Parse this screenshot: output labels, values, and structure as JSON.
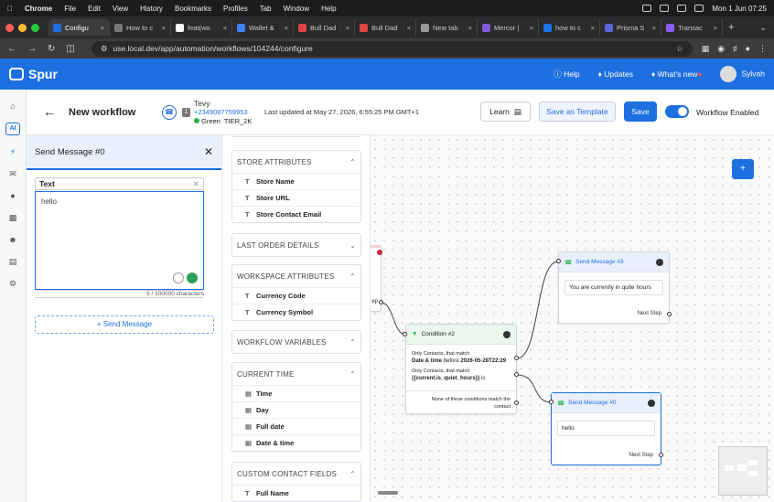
{
  "menubar": {
    "app": "Chrome",
    "items": [
      "File",
      "Edit",
      "View",
      "History",
      "Bookmarks",
      "Profiles",
      "Tab",
      "Window",
      "Help"
    ],
    "clock": "Mon 1 Jun  07:25"
  },
  "tabs": [
    {
      "label": "Configu",
      "color": "#1e6fe0",
      "active": true
    },
    {
      "label": "How to c",
      "color": "#777"
    },
    {
      "label": "feat(wo",
      "color": "#fff"
    },
    {
      "label": "Wallet &",
      "color": "#3c82f6"
    },
    {
      "label": "Bull Dad",
      "color": "#e04545"
    },
    {
      "label": "Bull Dad",
      "color": "#e04545"
    },
    {
      "label": "New tab",
      "color": "#999"
    },
    {
      "label": "Mercor |",
      "color": "#7b5bd6"
    },
    {
      "label": "how to c",
      "color": "#1a73e8"
    },
    {
      "label": "Prisma S",
      "color": "#5a67d8"
    },
    {
      "label": "Transac",
      "color": "#8b5cf6"
    }
  ],
  "address": {
    "url": "use.local.dev/app/automation/workflows/104244/configure"
  },
  "appbar": {
    "brand": "Spur",
    "help": "Help",
    "updates": "Updates",
    "whats_new": "What's new",
    "user": "Sylvah"
  },
  "sidebar": {
    "ai_label": "AI"
  },
  "header": {
    "title": "New workflow",
    "account_number": "1",
    "contact_name": "Tevy",
    "contact_phone": "+2349087759953",
    "status": "Green",
    "tier": "TIER_2K",
    "updated": "Last updated at May 27, 2026, 6:55:25 PM GMT+1",
    "learn": "Learn",
    "save_template": "Save as Template",
    "save": "Save",
    "toggle_label": "Workflow Enabled"
  },
  "panel": {
    "title": "Send Message #0",
    "text_label": "Text",
    "text_value": "hello",
    "counter": "5 / 100000 characters",
    "add_message": "+ Send Message"
  },
  "variables": {
    "store_attributes": {
      "title": "STORE ATTRIBUTES",
      "rows": [
        "Store Name",
        "Store URL",
        "Store Contact Email"
      ]
    },
    "last_order": {
      "title": "LAST ORDER DETAILS"
    },
    "workspace_attributes": {
      "title": "WORKSPACE ATTRIBUTES",
      "rows": [
        "Currency Code",
        "Currency Symbol"
      ]
    },
    "workflow_variables": {
      "title": "WORKFLOW VARIABLES"
    },
    "current_time": {
      "title": "CURRENT TIME",
      "rows": [
        "Time",
        "Day",
        "Full date",
        "Date & time"
      ]
    },
    "custom_contact": {
      "title": "CUSTOM CONTACT FIELDS",
      "rows": [
        "Full Name"
      ]
    }
  },
  "canvas": {
    "condition": {
      "title": "Condition #2",
      "line1": "Only Contacts, that match",
      "line2a": "Date & time",
      "line2b": "before",
      "line2c": "2026-05-28T22:29",
      "line3": "Only Contacts, that match",
      "line4a": "{{current.is_quiet_hours}}",
      "line4b": "is",
      "line5": "None of these conditions match the contact"
    },
    "send3": {
      "title": "Send Message #3",
      "message": "You are currently in quite hours",
      "next": "Next Step"
    },
    "send0": {
      "title": "Send Message #0",
      "message": "hello",
      "next": "Next Step"
    },
    "partial_label": "ep"
  }
}
